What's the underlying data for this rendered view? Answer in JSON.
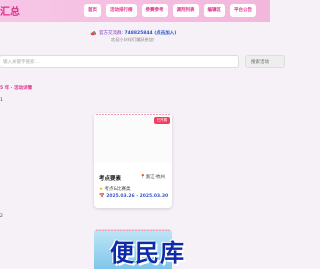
{
  "header": {
    "logo": "汇总",
    "nav": [
      "首页",
      "活动排行榜",
      "参赛参考",
      "调剂列表",
      "编辑区",
      "平台公告"
    ]
  },
  "notice": {
    "icon": "megaphone-icon",
    "line1_prefix": "官方交流群: ",
    "line1_value": "748825844 (点击加入)",
    "line2": "欢迎小伙伴们踊跃参加！"
  },
  "search": {
    "placeholder": "输入关键字搜索...",
    "button": "搜索活动"
  },
  "breadcrumb": "5 年 · 活动详情",
  "sections": [
    "1",
    "2"
  ],
  "cards": [
    {
      "badge": "已开展",
      "title": "考点要素",
      "location": "浙江·杭州",
      "type": "考点&比赛类",
      "date": "2025.03.26 - 2025.03.30"
    }
  ],
  "watermark": "便民库",
  "colors": {
    "accent": "#e0318f",
    "header_bg": "#f7c6e6",
    "badge": "#f04060",
    "date": "#3a56c8"
  }
}
